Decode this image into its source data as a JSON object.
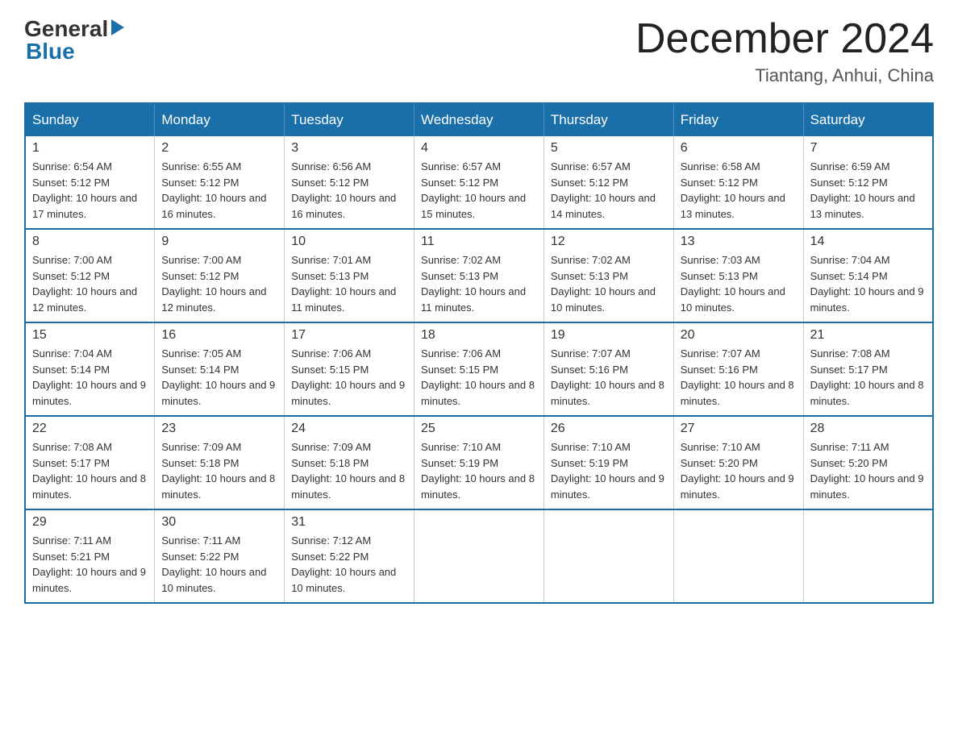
{
  "logo": {
    "general": "General",
    "blue": "Blue"
  },
  "header": {
    "month_title": "December 2024",
    "location": "Tiantang, Anhui, China"
  },
  "days_of_week": [
    "Sunday",
    "Monday",
    "Tuesday",
    "Wednesday",
    "Thursday",
    "Friday",
    "Saturday"
  ],
  "weeks": [
    [
      {
        "day": "1",
        "sunrise": "6:54 AM",
        "sunset": "5:12 PM",
        "daylight": "10 hours and 17 minutes."
      },
      {
        "day": "2",
        "sunrise": "6:55 AM",
        "sunset": "5:12 PM",
        "daylight": "10 hours and 16 minutes."
      },
      {
        "day": "3",
        "sunrise": "6:56 AM",
        "sunset": "5:12 PM",
        "daylight": "10 hours and 16 minutes."
      },
      {
        "day": "4",
        "sunrise": "6:57 AM",
        "sunset": "5:12 PM",
        "daylight": "10 hours and 15 minutes."
      },
      {
        "day": "5",
        "sunrise": "6:57 AM",
        "sunset": "5:12 PM",
        "daylight": "10 hours and 14 minutes."
      },
      {
        "day": "6",
        "sunrise": "6:58 AM",
        "sunset": "5:12 PM",
        "daylight": "10 hours and 13 minutes."
      },
      {
        "day": "7",
        "sunrise": "6:59 AM",
        "sunset": "5:12 PM",
        "daylight": "10 hours and 13 minutes."
      }
    ],
    [
      {
        "day": "8",
        "sunrise": "7:00 AM",
        "sunset": "5:12 PM",
        "daylight": "10 hours and 12 minutes."
      },
      {
        "day": "9",
        "sunrise": "7:00 AM",
        "sunset": "5:12 PM",
        "daylight": "10 hours and 12 minutes."
      },
      {
        "day": "10",
        "sunrise": "7:01 AM",
        "sunset": "5:13 PM",
        "daylight": "10 hours and 11 minutes."
      },
      {
        "day": "11",
        "sunrise": "7:02 AM",
        "sunset": "5:13 PM",
        "daylight": "10 hours and 11 minutes."
      },
      {
        "day": "12",
        "sunrise": "7:02 AM",
        "sunset": "5:13 PM",
        "daylight": "10 hours and 10 minutes."
      },
      {
        "day": "13",
        "sunrise": "7:03 AM",
        "sunset": "5:13 PM",
        "daylight": "10 hours and 10 minutes."
      },
      {
        "day": "14",
        "sunrise": "7:04 AM",
        "sunset": "5:14 PM",
        "daylight": "10 hours and 9 minutes."
      }
    ],
    [
      {
        "day": "15",
        "sunrise": "7:04 AM",
        "sunset": "5:14 PM",
        "daylight": "10 hours and 9 minutes."
      },
      {
        "day": "16",
        "sunrise": "7:05 AM",
        "sunset": "5:14 PM",
        "daylight": "10 hours and 9 minutes."
      },
      {
        "day": "17",
        "sunrise": "7:06 AM",
        "sunset": "5:15 PM",
        "daylight": "10 hours and 9 minutes."
      },
      {
        "day": "18",
        "sunrise": "7:06 AM",
        "sunset": "5:15 PM",
        "daylight": "10 hours and 8 minutes."
      },
      {
        "day": "19",
        "sunrise": "7:07 AM",
        "sunset": "5:16 PM",
        "daylight": "10 hours and 8 minutes."
      },
      {
        "day": "20",
        "sunrise": "7:07 AM",
        "sunset": "5:16 PM",
        "daylight": "10 hours and 8 minutes."
      },
      {
        "day": "21",
        "sunrise": "7:08 AM",
        "sunset": "5:17 PM",
        "daylight": "10 hours and 8 minutes."
      }
    ],
    [
      {
        "day": "22",
        "sunrise": "7:08 AM",
        "sunset": "5:17 PM",
        "daylight": "10 hours and 8 minutes."
      },
      {
        "day": "23",
        "sunrise": "7:09 AM",
        "sunset": "5:18 PM",
        "daylight": "10 hours and 8 minutes."
      },
      {
        "day": "24",
        "sunrise": "7:09 AM",
        "sunset": "5:18 PM",
        "daylight": "10 hours and 8 minutes."
      },
      {
        "day": "25",
        "sunrise": "7:10 AM",
        "sunset": "5:19 PM",
        "daylight": "10 hours and 8 minutes."
      },
      {
        "day": "26",
        "sunrise": "7:10 AM",
        "sunset": "5:19 PM",
        "daylight": "10 hours and 9 minutes."
      },
      {
        "day": "27",
        "sunrise": "7:10 AM",
        "sunset": "5:20 PM",
        "daylight": "10 hours and 9 minutes."
      },
      {
        "day": "28",
        "sunrise": "7:11 AM",
        "sunset": "5:20 PM",
        "daylight": "10 hours and 9 minutes."
      }
    ],
    [
      {
        "day": "29",
        "sunrise": "7:11 AM",
        "sunset": "5:21 PM",
        "daylight": "10 hours and 9 minutes."
      },
      {
        "day": "30",
        "sunrise": "7:11 AM",
        "sunset": "5:22 PM",
        "daylight": "10 hours and 10 minutes."
      },
      {
        "day": "31",
        "sunrise": "7:12 AM",
        "sunset": "5:22 PM",
        "daylight": "10 hours and 10 minutes."
      },
      null,
      null,
      null,
      null
    ]
  ]
}
